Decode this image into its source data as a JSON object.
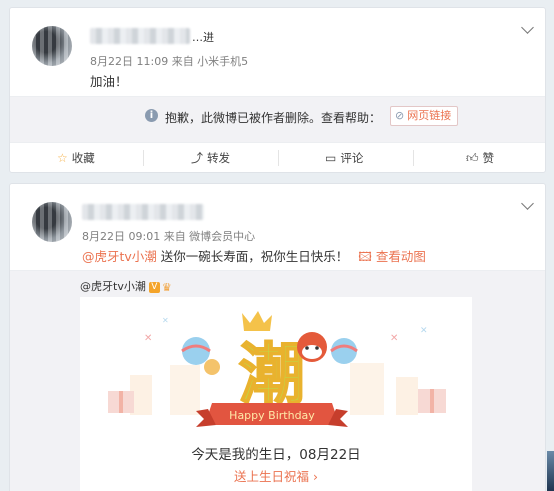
{
  "post1": {
    "name_suffix": "…进",
    "meta": "8月22日 11:09 来自 小米手机5",
    "text": "加油！",
    "deleted_notice": "抱歉，此微博已被作者删除。查看帮助：",
    "help_link": "网页链接",
    "actions": {
      "favorite": "收藏",
      "repost": "转发",
      "comment": "评论",
      "like": "赞"
    }
  },
  "post2": {
    "meta": "8月22日 09:01 来自 微博会员中心",
    "mention": "@虎牙tv小潮",
    "text": " 送你一碗长寿面，祝你生日快乐！",
    "view_anim": "查看动图",
    "repost": {
      "author": "@虎牙tv小潮",
      "card": {
        "big_char": "潮",
        "banner": "Happy Birthday",
        "line1": "今天是我的生日，08月22日",
        "line2": "送上生日祝福 ›"
      }
    }
  },
  "colors": {
    "accent": "#eb7350",
    "bg": "#e9eef2"
  }
}
